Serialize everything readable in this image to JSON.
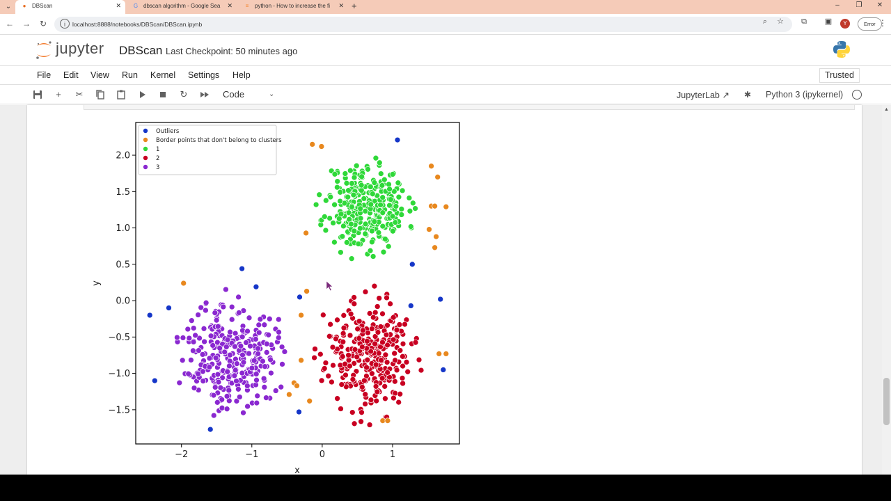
{
  "browser": {
    "tabs": [
      {
        "title": "DBScan",
        "active": true
      },
      {
        "title": "dbscan algorithm - Google Sea"
      },
      {
        "title": "python - How to increase the fi"
      }
    ],
    "url": "localhost:8888/notebooks/DBScan/DBScan.ipynb",
    "error_label": "Error",
    "avatar_letter": "Y"
  },
  "header": {
    "brand": "jupyter",
    "notebook_title": "DBScan",
    "checkpoint": "Last Checkpoint: 50 minutes ago"
  },
  "menu": [
    "File",
    "Edit",
    "View",
    "Run",
    "Kernel",
    "Settings",
    "Help"
  ],
  "trusted_label": "Trusted",
  "toolbar": {
    "cell_type": "Code",
    "jupyterlab_label": "JupyterLab",
    "kernel_name": "Python 3 (ipykernel)"
  },
  "icons": {
    "save": "save-icon",
    "add": "plus-icon",
    "cut": "scissors-icon",
    "copy": "copy-icon",
    "paste": "paste-icon",
    "run": "play-icon",
    "stop": "stop-icon",
    "restart": "restart-icon",
    "run_all": "fast-forward-icon"
  },
  "chart_data": {
    "type": "scatter",
    "xlabel": "x",
    "ylabel": "y",
    "xlim": [
      -2.65,
      1.95
    ],
    "ylim": [
      -1.97,
      2.45
    ],
    "xticks": [
      -2,
      -1,
      0,
      1
    ],
    "xtick_labels": [
      "−2",
      "−1",
      "0",
      "1"
    ],
    "yticks": [
      -1.5,
      -1.0,
      -0.5,
      0.0,
      0.5,
      1.0,
      1.5,
      2.0
    ],
    "ytick_labels": [
      "−1.5",
      "−1.0",
      "−0.5",
      "0.0",
      "0.5",
      "1.0",
      "1.5",
      "2.0"
    ],
    "legend_position": "top-left",
    "series": [
      {
        "name": "Outliers",
        "color": "#1536c8",
        "points": [
          [
            -2.45,
            -0.2
          ],
          [
            -2.38,
            -1.1
          ],
          [
            -2.18,
            -0.1
          ],
          [
            -1.59,
            -1.77
          ],
          [
            -1.14,
            0.44
          ],
          [
            -0.94,
            0.19
          ],
          [
            -0.32,
            0.05
          ],
          [
            -0.33,
            -1.53
          ],
          [
            1.07,
            2.21
          ],
          [
            1.26,
            -0.07
          ],
          [
            1.28,
            0.5
          ],
          [
            1.68,
            0.02
          ],
          [
            1.72,
            -0.95
          ]
        ]
      },
      {
        "name": "Border points that don't belong to clusters",
        "color": "#e8881e",
        "points": [
          [
            -1.97,
            0.24
          ],
          [
            -0.4,
            -1.13
          ],
          [
            -0.47,
            -1.29
          ],
          [
            -0.36,
            -1.17
          ],
          [
            -0.3,
            -0.82
          ],
          [
            -0.3,
            -0.2
          ],
          [
            -0.18,
            -1.38
          ],
          [
            -0.22,
            0.13
          ],
          [
            -0.23,
            0.93
          ],
          [
            -0.14,
            2.15
          ],
          [
            -0.01,
            2.12
          ],
          [
            0.86,
            -1.65
          ],
          [
            0.93,
            -1.65
          ],
          [
            1.52,
            0.98
          ],
          [
            1.6,
            0.73
          ],
          [
            1.62,
            0.88
          ],
          [
            1.55,
            1.3
          ],
          [
            1.6,
            1.3
          ],
          [
            1.76,
            1.29
          ],
          [
            1.64,
            1.7
          ],
          [
            1.55,
            1.85
          ],
          [
            1.66,
            -0.73
          ],
          [
            1.76,
            -0.73
          ]
        ]
      },
      {
        "name": "1",
        "color": "#2fd839",
        "center": [
          0.63,
          1.3
        ],
        "spread": [
          0.29,
          0.3
        ],
        "count": 300,
        "seed": 11
      },
      {
        "name": "2",
        "color": "#c80021",
        "center": [
          0.65,
          -0.75
        ],
        "spread": [
          0.3,
          0.38
        ],
        "count": 300,
        "seed": 23
      },
      {
        "name": "3",
        "color": "#8a28d0",
        "center": [
          -1.3,
          -0.72
        ],
        "spread": [
          0.32,
          0.36
        ],
        "count": 300,
        "seed": 37
      }
    ]
  }
}
